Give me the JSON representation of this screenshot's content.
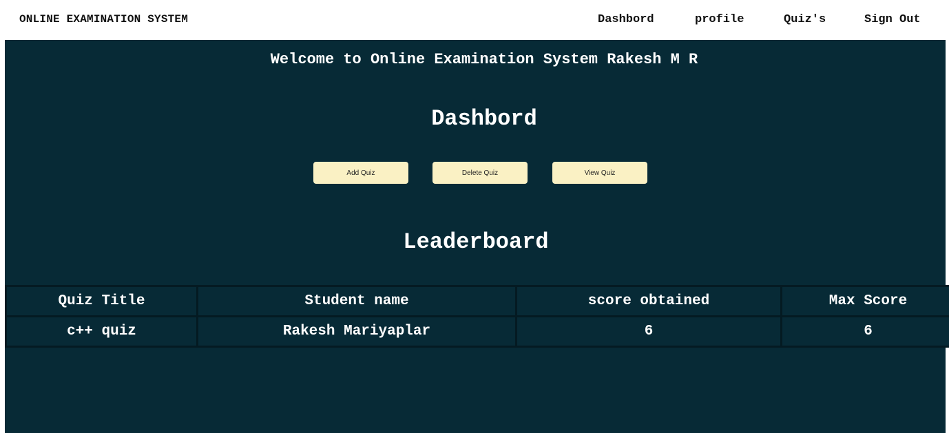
{
  "navbar": {
    "brand": "ONLINE EXAMINATION SYSTEM",
    "links": {
      "dashboard": "Dashbord",
      "profile": "profile",
      "quizzes": "Quiz's",
      "sign_out": "Sign Out"
    }
  },
  "main": {
    "welcome": "Welcome to Online Examination System Rakesh M R",
    "dashboard_heading": "Dashbord",
    "buttons": {
      "add": "Add Quiz",
      "delete": "Delete Quiz",
      "view": "View Quiz"
    },
    "leaderboard": {
      "heading": "Leaderboard",
      "columns": [
        "Quiz Title",
        "Student name",
        "score obtained",
        "Max Score"
      ],
      "rows": [
        [
          "c++ quiz",
          "Rakesh Mariyaplar",
          "6",
          "6"
        ]
      ]
    }
  },
  "colors": {
    "background": "#072a36",
    "button": "#faf1c4",
    "navbar": "#ffffff"
  }
}
